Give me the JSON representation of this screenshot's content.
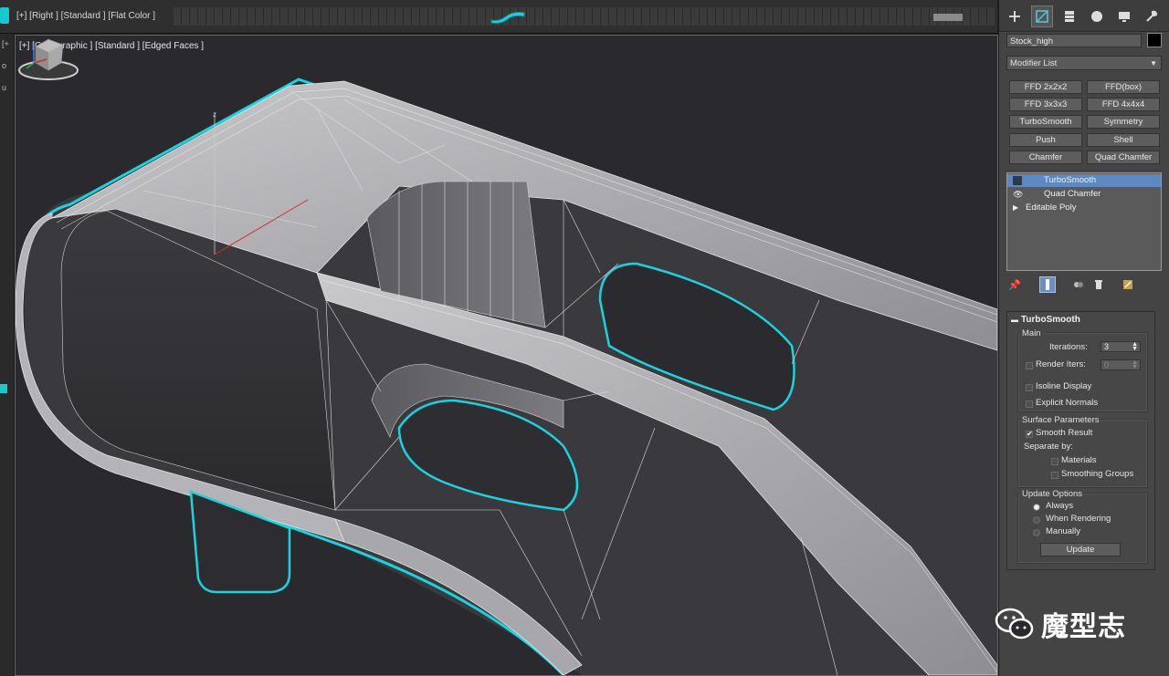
{
  "top_viewport": {
    "label": "[+] [Right ] [Standard ] [Flat Color ]"
  },
  "left_viewport": {
    "tick_labels": [
      "[+",
      "o",
      "u"
    ]
  },
  "main_viewport": {
    "label": "[+] [Orthographic ] [Standard ] [Edged Faces ]",
    "axis_label": "z"
  },
  "command_panel": {
    "tabs": [
      {
        "name": "create",
        "icon": "plus-icon"
      },
      {
        "name": "modify",
        "icon": "modify-icon",
        "active": true
      },
      {
        "name": "hierarchy",
        "icon": "hierarchy-icon"
      },
      {
        "name": "motion",
        "icon": "motion-icon"
      },
      {
        "name": "display",
        "icon": "display-icon"
      },
      {
        "name": "utilities",
        "icon": "wrench-icon"
      }
    ],
    "object_name": "Stock_high",
    "object_color": "#000000",
    "modifier_list": "Modifier List",
    "modifier_buttons": [
      "FFD 2x2x2",
      "FFD(box)",
      "FFD 3x3x3",
      "FFD 4x4x4",
      "TurboSmooth",
      "Symmetry",
      "Push",
      "Shell",
      "Chamfer",
      "Quad Chamfer"
    ],
    "stack": [
      {
        "label": "TurboSmooth",
        "selected": true
      },
      {
        "label": "Quad Chamfer",
        "icon": "eye-icon"
      },
      {
        "label": "Editable Poly",
        "icon": "expand-triangle-icon"
      }
    ],
    "stack_tools": [
      "pin-stack-icon",
      "show-end-result-icon",
      "make-unique-icon",
      "remove-modifier-icon",
      "configure-sets-icon"
    ]
  },
  "turbosmooth": {
    "title": "TurboSmooth",
    "main": {
      "title": "Main",
      "iterations_label": "Iterations:",
      "iterations_value": "3",
      "render_iters_label": "Render Iters:",
      "render_iters_value": "0",
      "render_iters_checked": false,
      "isoline_label": "Isoline Display",
      "isoline_checked": false,
      "explicit_normals_label": "Explicit Normals",
      "explicit_normals_checked": false
    },
    "surface": {
      "title": "Surface Parameters",
      "smooth_result_label": "Smooth Result",
      "smooth_result_checked": true,
      "separate_by_label": "Separate by:",
      "materials_label": "Materials",
      "materials_checked": false,
      "smoothing_groups_label": "Smoothing Groups",
      "smoothing_groups_checked": false
    },
    "update": {
      "title": "Update Options",
      "options": [
        {
          "label": "Always",
          "selected": true
        },
        {
          "label": "When Rendering",
          "selected": false
        },
        {
          "label": "Manually",
          "selected": false
        }
      ],
      "update_button": "Update"
    }
  },
  "watermark": {
    "text": "魔型志",
    "icon": "wechat-icon"
  },
  "colors": {
    "selection_cyan": "#19d4dc",
    "accent_blue": "#5d89c0",
    "panel_bg": "#444444"
  }
}
